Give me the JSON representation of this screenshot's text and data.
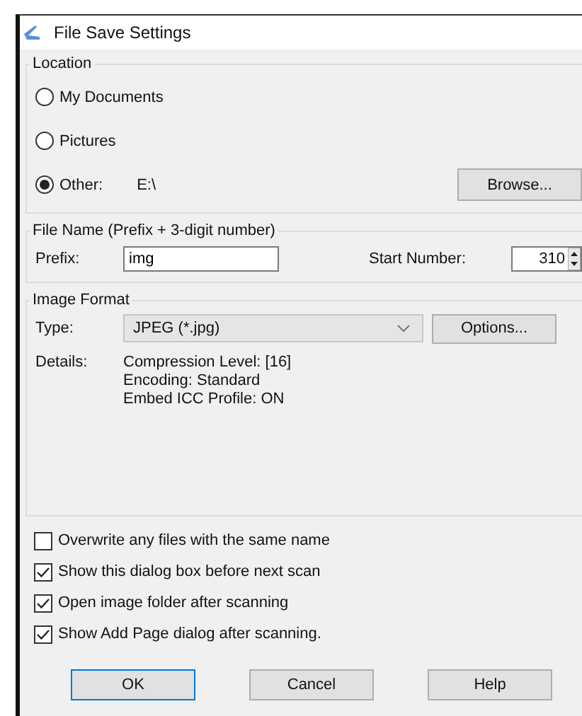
{
  "window": {
    "title": "File Save Settings"
  },
  "location": {
    "legend": "Location",
    "options": [
      {
        "label": "My Documents",
        "selected": false
      },
      {
        "label": "Pictures",
        "selected": false
      },
      {
        "label": "Other:",
        "selected": true,
        "value": "E:\\"
      }
    ],
    "browse_button": "Browse..."
  },
  "file_name": {
    "legend": "File Name (Prefix + 3-digit number)",
    "prefix_label": "Prefix:",
    "prefix_value": "img",
    "start_label": "Start Number:",
    "start_value": "310"
  },
  "image_format": {
    "legend": "Image Format",
    "type_label": "Type:",
    "type_value": "JPEG (*.jpg)",
    "options_button": "Options...",
    "details_label": "Details:",
    "details": [
      "Compression Level: [16]",
      "Encoding: Standard",
      "Embed ICC Profile: ON"
    ]
  },
  "checkboxes": [
    {
      "label": "Overwrite any files with the same name",
      "checked": false
    },
    {
      "label": "Show this dialog box before next scan",
      "checked": true
    },
    {
      "label": "Open image folder after scanning",
      "checked": true
    },
    {
      "label": "Show Add Page dialog after scanning.",
      "checked": true
    }
  ],
  "buttons": [
    {
      "label": "OK",
      "kind": "default"
    },
    {
      "label": "Cancel",
      "kind": "normal"
    },
    {
      "label": "Help",
      "kind": "normal"
    }
  ]
}
